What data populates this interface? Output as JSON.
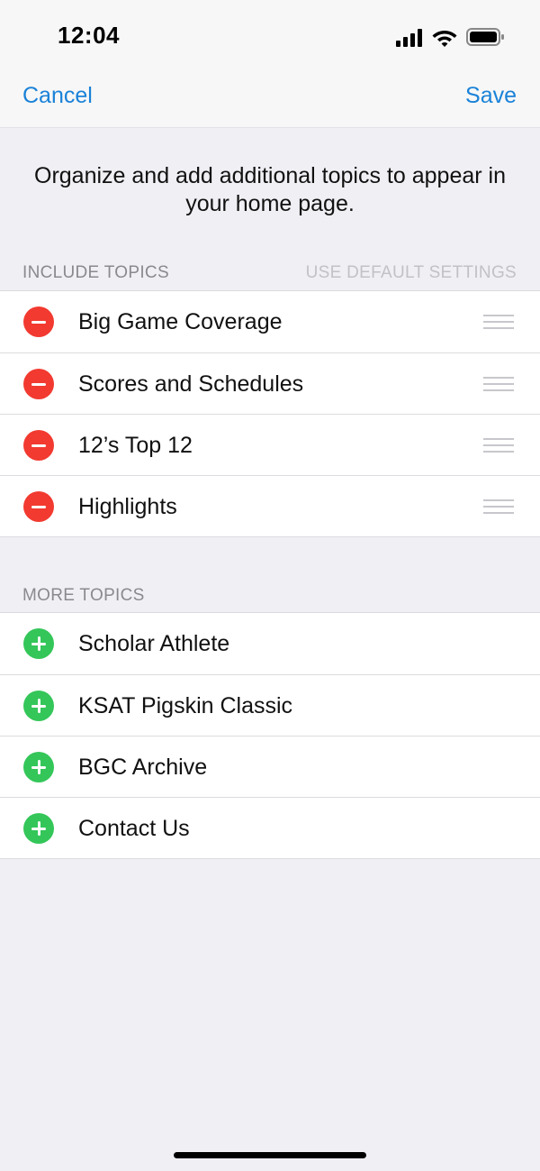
{
  "status_bar": {
    "time": "12:04",
    "icons": [
      "cellular-signal-icon",
      "wifi-icon",
      "battery-icon"
    ]
  },
  "nav": {
    "cancel_label": "Cancel",
    "save_label": "Save",
    "accent_color": "#1a82d8"
  },
  "intro_text": "Organize and add additional topics to appear in your home page.",
  "include_section": {
    "header": "INCLUDE TOPICS",
    "action": "USE DEFAULT SETTINGS",
    "items": [
      {
        "label": "Big Game Coverage"
      },
      {
        "label": "Scores and Schedules"
      },
      {
        "label": "12’s Top 12"
      },
      {
        "label": "Highlights"
      }
    ]
  },
  "more_section": {
    "header": "MORE TOPICS",
    "items": [
      {
        "label": "Scholar Athlete"
      },
      {
        "label": "KSAT Pigskin Classic"
      },
      {
        "label": "BGC Archive"
      },
      {
        "label": "Contact Us"
      }
    ]
  },
  "colors": {
    "remove": "#f23a30",
    "add": "#34c659"
  }
}
